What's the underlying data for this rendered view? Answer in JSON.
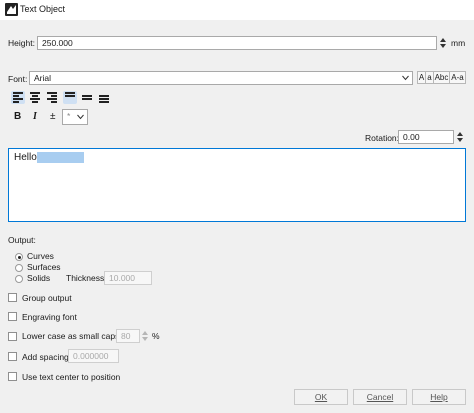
{
  "window": {
    "title": "Text Object"
  },
  "height": {
    "label": "Height:",
    "value": "250.000",
    "unit": "mm"
  },
  "font": {
    "label": "Font:",
    "value": "Arial",
    "case_buttons": [
      "A",
      "a",
      "Abc",
      "A-a"
    ]
  },
  "format": {
    "bold": "B",
    "italic": "I",
    "strike": "±",
    "symbol_value": "*"
  },
  "rotation": {
    "label": "Rotation:",
    "value": "0.00"
  },
  "text_area": {
    "text": "Hello",
    "selection_color": "#a8cdf0"
  },
  "output": {
    "label": "Output:",
    "options": [
      "Curves",
      "Surfaces",
      "Solids"
    ],
    "selected": "Curves",
    "thickness_label": "Thickness:",
    "thickness_value": "10.000"
  },
  "checkboxes": {
    "group_output": "Group output",
    "engraving_font": "Engraving font",
    "lower_case": "Lower case as small caps",
    "lower_case_value": "80",
    "lower_case_unit": "%",
    "add_spacing": "Add spacing",
    "add_spacing_value": "0.000000",
    "use_text_center": "Use text center to position"
  },
  "buttons": {
    "ok": "OK",
    "cancel": "Cancel",
    "help": "Help"
  },
  "colors": {
    "accent_blue": "#0078d7",
    "active_align": "#cfe0f3"
  }
}
